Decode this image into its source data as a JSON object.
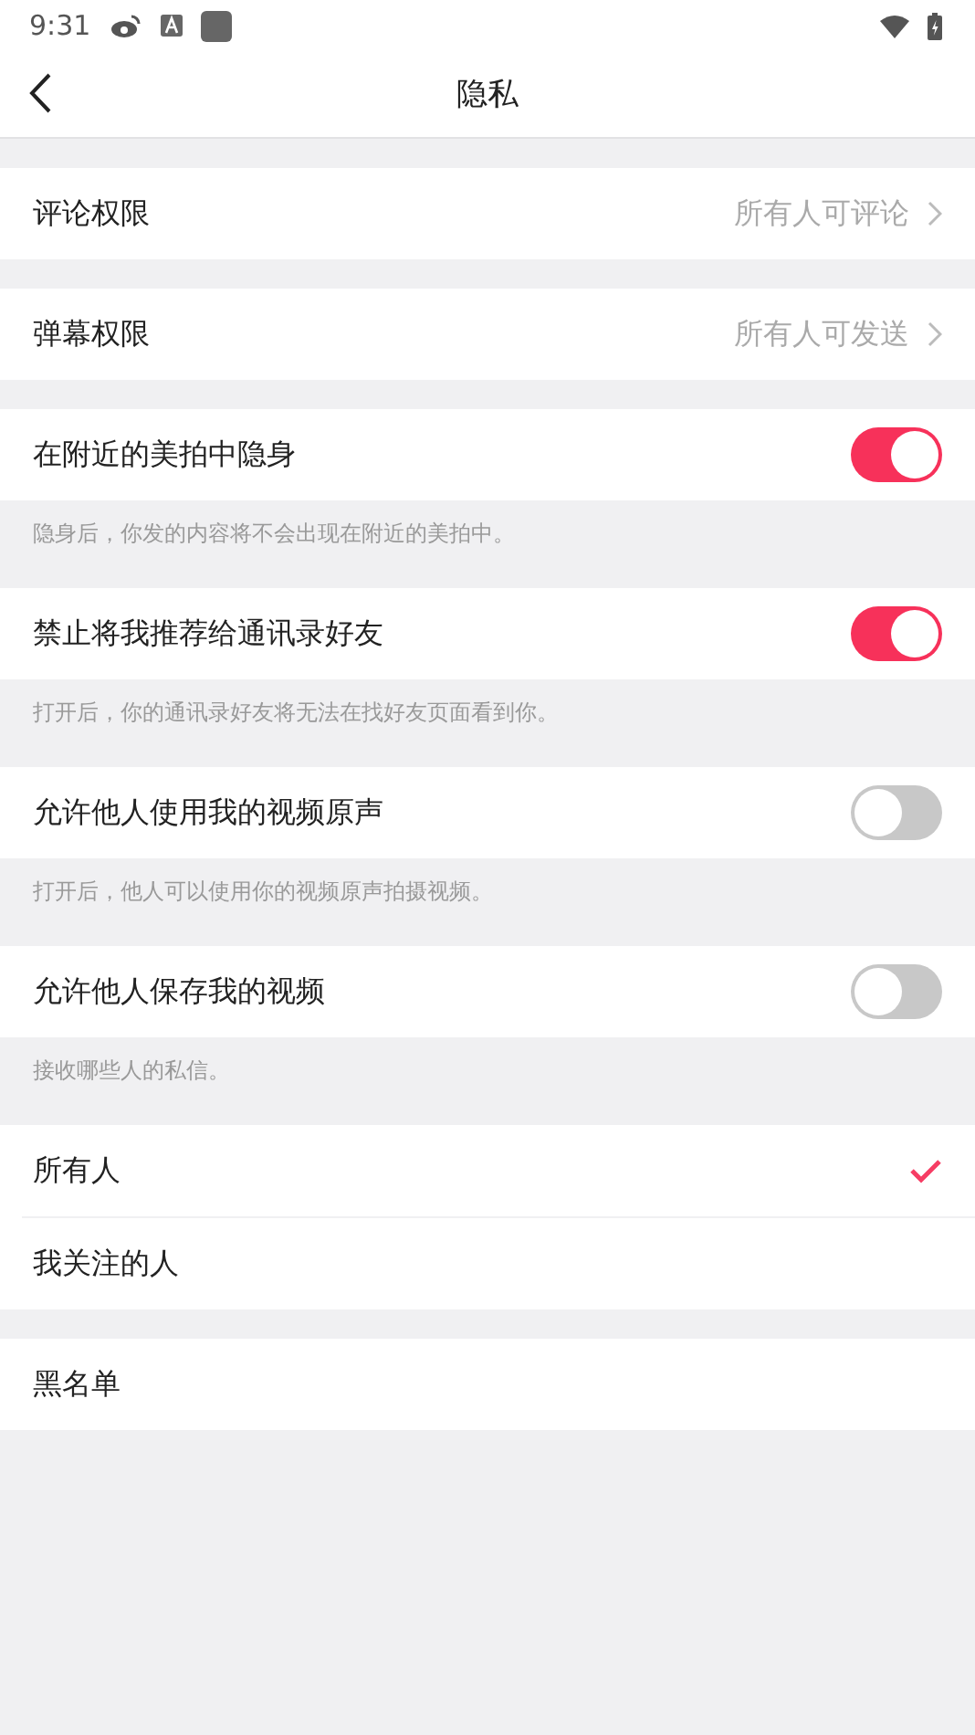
{
  "status_bar": {
    "time": "9:31"
  },
  "nav": {
    "title": "隐私"
  },
  "sections": [
    {
      "rows": [
        {
          "kind": "link",
          "label": "评论权限",
          "value": "所有人可评论"
        }
      ]
    },
    {
      "rows": [
        {
          "kind": "link",
          "label": "弹幕权限",
          "value": "所有人可发送"
        }
      ]
    },
    {
      "rows": [
        {
          "kind": "toggle",
          "label": "在附近的美拍中隐身",
          "on": true
        }
      ],
      "note": "隐身后，你发的内容将不会出现在附近的美拍中。"
    },
    {
      "rows": [
        {
          "kind": "toggle",
          "label": "禁止将我推荐给通讯录好友",
          "on": true
        }
      ],
      "note": "打开后，你的通讯录好友将无法在找好友页面看到你。"
    },
    {
      "rows": [
        {
          "kind": "toggle",
          "label": "允许他人使用我的视频原声",
          "on": false
        }
      ],
      "note": "打开后，他人可以使用你的视频原声拍摄视频。"
    },
    {
      "rows": [
        {
          "kind": "toggle",
          "label": "允许他人保存我的视频",
          "on": false
        }
      ],
      "note": "接收哪些人的私信。"
    },
    {
      "rows": [
        {
          "kind": "choice",
          "label": "所有人",
          "selected": true
        },
        {
          "kind": "choice",
          "label": "我关注的人",
          "selected": false
        }
      ]
    },
    {
      "rows": [
        {
          "kind": "plain",
          "label": "黑名单"
        }
      ]
    }
  ]
}
